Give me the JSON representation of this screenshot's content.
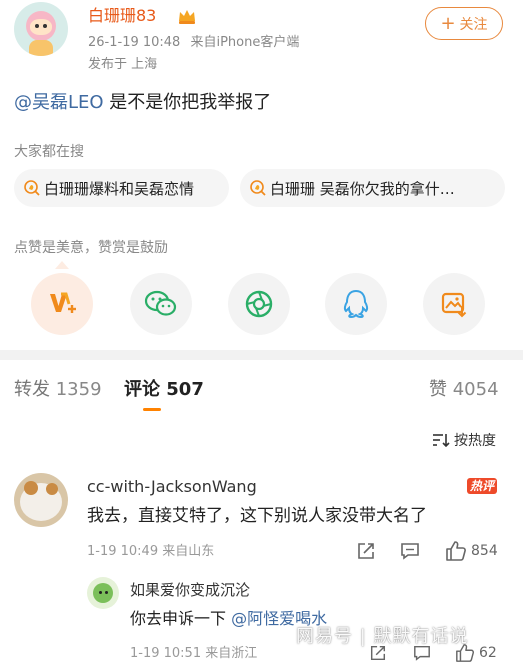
{
  "post": {
    "user_name": "白珊珊83",
    "time": "26-1-19 10:48",
    "source": "来自iPhone客户端",
    "location": "发布于 上海",
    "follow_label": "关注",
    "mention": "@吴磊LEO",
    "text": " 是不是你把我举报了"
  },
  "search": {
    "label": "大家都在搜",
    "chips": [
      "白珊珊爆料和吴磊恋情",
      "白珊珊 吴磊你欠我的拿什…"
    ]
  },
  "like_tip": "点赞是美意，赞赏是鼓励",
  "tabs": {
    "repost_label": "转发",
    "repost_count": "1359",
    "comment_label": "评论",
    "comment_count": "507",
    "like_label": "赞",
    "like_count": "4054"
  },
  "sort_label": "按热度",
  "comments": [
    {
      "name": "cc-with-JacksonWang",
      "badge": "热评",
      "text": "我去，直接艾特了，这下别说人家没带大名了",
      "meta": "1-19 10:49  来自山东",
      "likes": "854",
      "reply": {
        "name": "如果爱你变成沉沦",
        "text_prefix": "你去申诉一下 ",
        "mention": "@阿怪爱喝水",
        "meta": "1-19 10:51  来自浙江",
        "likes": "62"
      }
    }
  ],
  "watermark": "网易号 | 默默有话说",
  "colors": {
    "accent_orange": "#ff8200",
    "name_orange": "#e85a1a",
    "link_blue": "#3f6aa1",
    "wechat_green": "#2aae67",
    "qq_blue": "#3aa3e3"
  },
  "icons": [
    "vip-crown-icon",
    "reward-icon",
    "wechat-icon",
    "moments-icon",
    "qq-icon",
    "save-image-icon",
    "sort-icon",
    "share-icon",
    "comment-icon",
    "like-icon"
  ]
}
